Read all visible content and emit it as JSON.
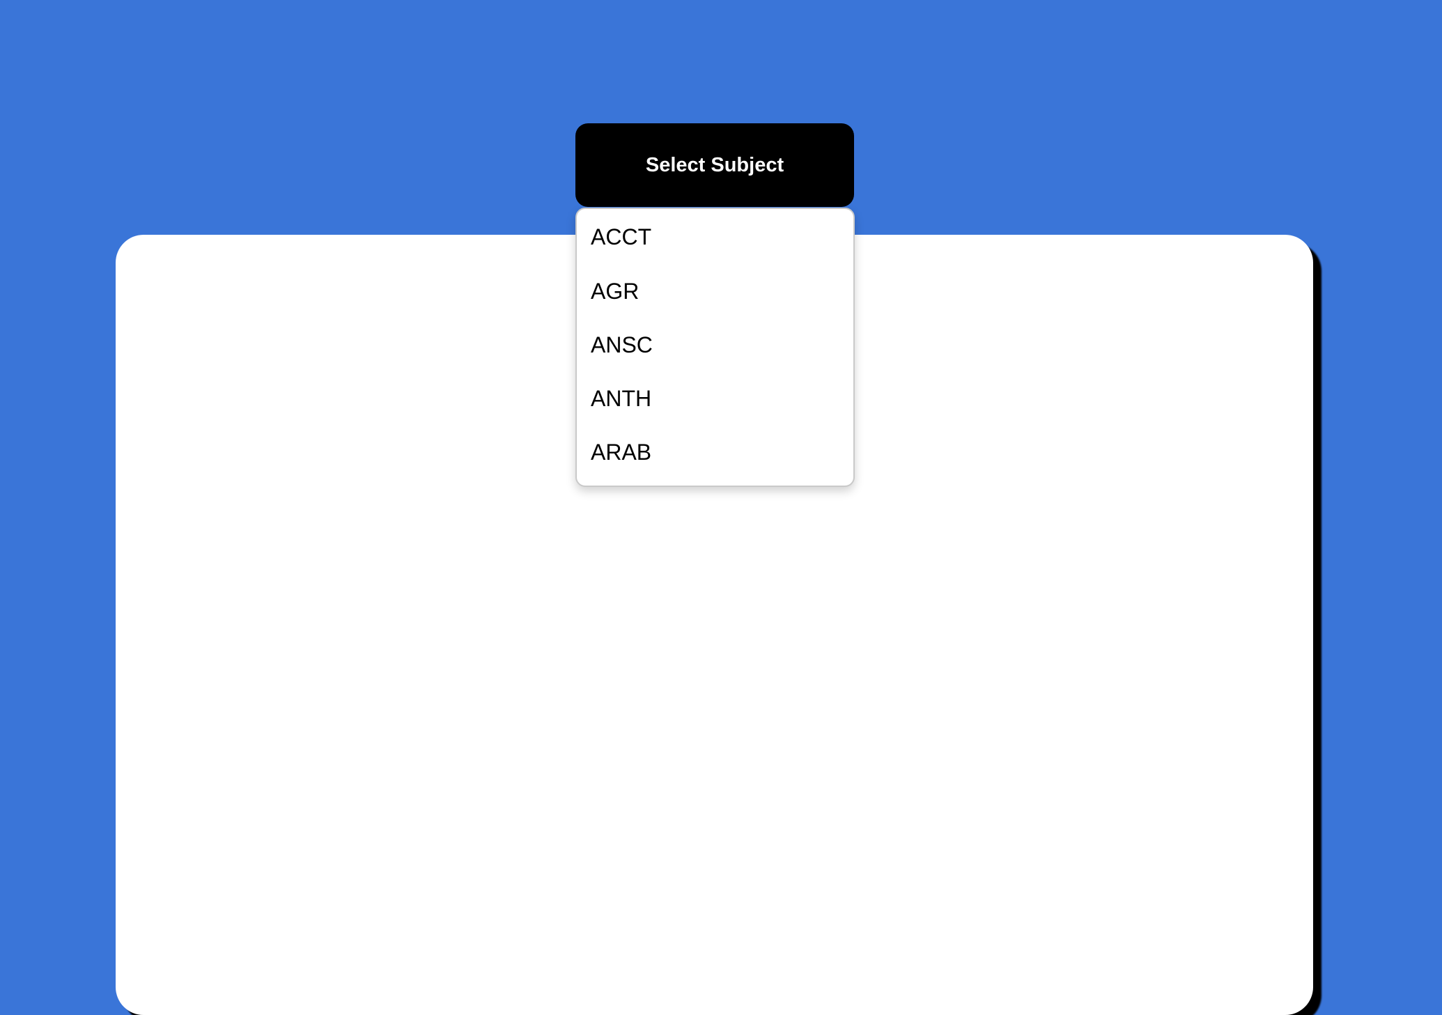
{
  "page": {
    "background_color": "#3a75d8",
    "card_color": "#ffffff"
  },
  "subject_selector": {
    "button_label": "Select Subject",
    "button_color": "#000000",
    "options": [
      {
        "label": "ACCT"
      },
      {
        "label": "AGR"
      },
      {
        "label": "ANSC"
      },
      {
        "label": "ANTH"
      },
      {
        "label": "ARAB"
      }
    ]
  }
}
